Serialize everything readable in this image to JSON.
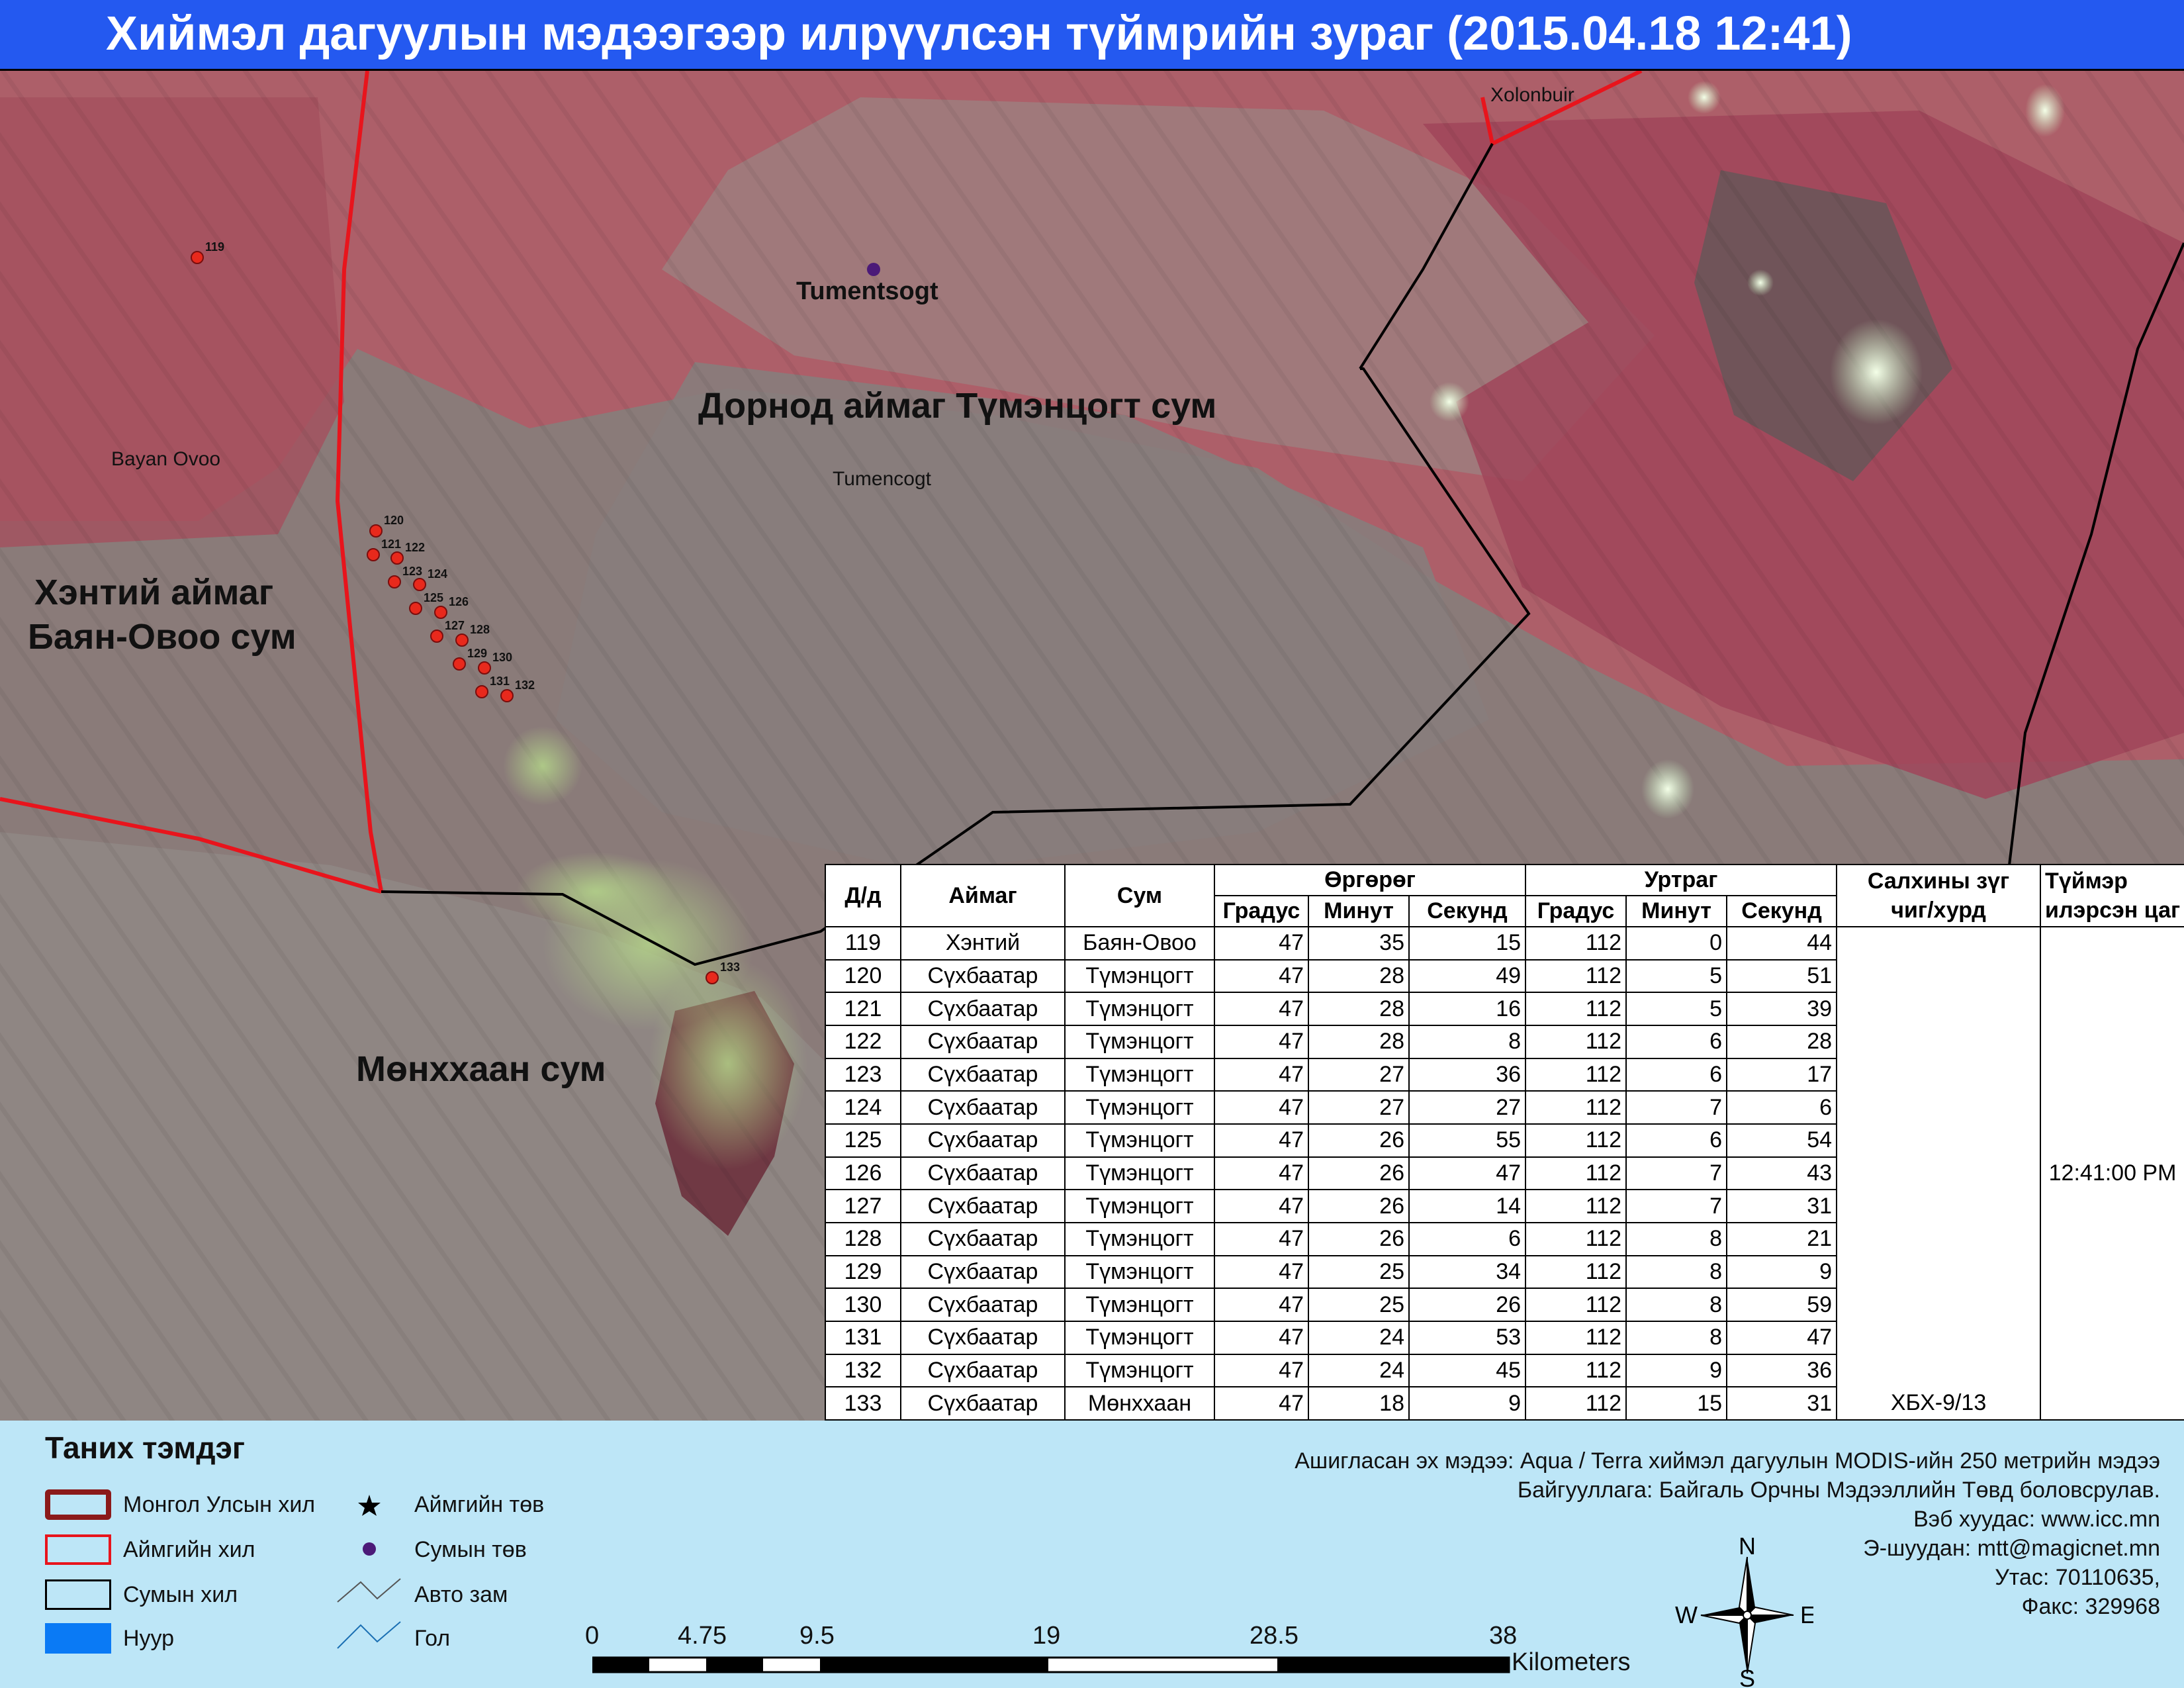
{
  "title": "Хиймэл дагуулын мэдээгээр илрүүлсэн түймрийн зураг  (2015.04.18 12:41)",
  "map": {
    "labels": {
      "bayan_ovoo_en": "Bayan Ovoo",
      "tumentsogt_en": "Tumentsogt",
      "tumencogt_en": "Tumencogt",
      "xolonbuir_en": "Xolonbuir",
      "dornod": "Дорнод аймаг Түмэнцогт сум",
      "khentii_line1": "Хэнтий аймаг",
      "khentii_line2": "Баян-Овоо сум",
      "munkhkhaan": "Мөнххаан сум"
    },
    "fire_points": [
      {
        "id": "119"
      },
      {
        "id": "120"
      },
      {
        "id": "121"
      },
      {
        "id": "122"
      },
      {
        "id": "123"
      },
      {
        "id": "124"
      },
      {
        "id": "125"
      },
      {
        "id": "126"
      },
      {
        "id": "127"
      },
      {
        "id": "128"
      },
      {
        "id": "129"
      },
      {
        "id": "130"
      },
      {
        "id": "131"
      },
      {
        "id": "132"
      },
      {
        "id": "133"
      }
    ],
    "colors": {
      "fire_point": "#e8291c",
      "aimag_border": "#e8141c",
      "sum_border": "#000000",
      "sum_center": "#4b1a78"
    }
  },
  "table": {
    "headers": {
      "id": "Д/д",
      "aimag": "Аймаг",
      "sum": "Сум",
      "latitude": "Өргөрөг",
      "longitude": "Уртраг",
      "deg": "Градус",
      "min": "Минут",
      "sec": "Секунд",
      "wind_line1": "Салхины зүг",
      "wind_line2": "чиг/хурд",
      "time_line1": "Түймэр",
      "time_line2": "илэрсэн цаг"
    },
    "rows": [
      {
        "id": "119",
        "aimag": "Хэнтий",
        "sum": "Баян-Овоо",
        "lat_deg": "47",
        "lat_min": "35",
        "lat_sec": "15",
        "lon_deg": "112",
        "lon_min": "0",
        "lon_sec": "44"
      },
      {
        "id": "120",
        "aimag": "Сүхбаатар",
        "sum": "Түмэнцогт",
        "lat_deg": "47",
        "lat_min": "28",
        "lat_sec": "49",
        "lon_deg": "112",
        "lon_min": "5",
        "lon_sec": "51"
      },
      {
        "id": "121",
        "aimag": "Сүхбаатар",
        "sum": "Түмэнцогт",
        "lat_deg": "47",
        "lat_min": "28",
        "lat_sec": "16",
        "lon_deg": "112",
        "lon_min": "5",
        "lon_sec": "39"
      },
      {
        "id": "122",
        "aimag": "Сүхбаатар",
        "sum": "Түмэнцогт",
        "lat_deg": "47",
        "lat_min": "28",
        "lat_sec": "8",
        "lon_deg": "112",
        "lon_min": "6",
        "lon_sec": "28"
      },
      {
        "id": "123",
        "aimag": "Сүхбаатар",
        "sum": "Түмэнцогт",
        "lat_deg": "47",
        "lat_min": "27",
        "lat_sec": "36",
        "lon_deg": "112",
        "lon_min": "6",
        "lon_sec": "17"
      },
      {
        "id": "124",
        "aimag": "Сүхбаатар",
        "sum": "Түмэнцогт",
        "lat_deg": "47",
        "lat_min": "27",
        "lat_sec": "27",
        "lon_deg": "112",
        "lon_min": "7",
        "lon_sec": "6"
      },
      {
        "id": "125",
        "aimag": "Сүхбаатар",
        "sum": "Түмэнцогт",
        "lat_deg": "47",
        "lat_min": "26",
        "lat_sec": "55",
        "lon_deg": "112",
        "lon_min": "6",
        "lon_sec": "54"
      },
      {
        "id": "126",
        "aimag": "Сүхбаатар",
        "sum": "Түмэнцогт",
        "lat_deg": "47",
        "lat_min": "26",
        "lat_sec": "47",
        "lon_deg": "112",
        "lon_min": "7",
        "lon_sec": "43"
      },
      {
        "id": "127",
        "aimag": "Сүхбаатар",
        "sum": "Түмэнцогт",
        "lat_deg": "47",
        "lat_min": "26",
        "lat_sec": "14",
        "lon_deg": "112",
        "lon_min": "7",
        "lon_sec": "31"
      },
      {
        "id": "128",
        "aimag": "Сүхбаатар",
        "sum": "Түмэнцогт",
        "lat_deg": "47",
        "lat_min": "26",
        "lat_sec": "6",
        "lon_deg": "112",
        "lon_min": "8",
        "lon_sec": "21"
      },
      {
        "id": "129",
        "aimag": "Сүхбаатар",
        "sum": "Түмэнцогт",
        "lat_deg": "47",
        "lat_min": "25",
        "lat_sec": "34",
        "lon_deg": "112",
        "lon_min": "8",
        "lon_sec": "9"
      },
      {
        "id": "130",
        "aimag": "Сүхбаатар",
        "sum": "Түмэнцогт",
        "lat_deg": "47",
        "lat_min": "25",
        "lat_sec": "26",
        "lon_deg": "112",
        "lon_min": "8",
        "lon_sec": "59"
      },
      {
        "id": "131",
        "aimag": "Сүхбаатар",
        "sum": "Түмэнцогт",
        "lat_deg": "47",
        "lat_min": "24",
        "lat_sec": "53",
        "lon_deg": "112",
        "lon_min": "8",
        "lon_sec": "47"
      },
      {
        "id": "132",
        "aimag": "Сүхбаатар",
        "sum": "Түмэнцогт",
        "lat_deg": "47",
        "lat_min": "24",
        "lat_sec": "45",
        "lon_deg": "112",
        "lon_min": "9",
        "lon_sec": "36"
      },
      {
        "id": "133",
        "aimag": "Сүхбаатар",
        "sum": "Мөнххаан",
        "lat_deg": "47",
        "lat_min": "18",
        "lat_sec": "9",
        "lon_deg": "112",
        "lon_min": "15",
        "lon_sec": "31"
      }
    ],
    "wind_value": "ХБХ-9/13",
    "detected_time": "12:41:00 PM"
  },
  "legend": {
    "title": "Таних тэмдэг",
    "items": {
      "country_border": "Монгол Улсын хил",
      "aimag_border": "Аймгийн хил",
      "sum_border": "Сумын хил",
      "lake": "Нуур",
      "aimag_center": "Аймгийн төв",
      "sum_center": "Сумын төв",
      "road": "Авто зам",
      "river": "Гол"
    },
    "colors": {
      "country_border": "#8b1a1a",
      "aimag_border": "#e8141c",
      "lake": "#0a7af5",
      "road": "#555555",
      "river": "#1a6fb3"
    }
  },
  "info": {
    "source": "Ашигласан эх мэдээ: Aqua / Terra хиймэл дагуулын MODIS-ийн 250 метрийн мэдээ",
    "org": "Байгууллага: Байгаль Орчны Мэдээллийн Төвд боловсрулав.",
    "web": "Вэб хуудас: www.icc.mn",
    "email": "Э-шуудан: mtt@magicnet.mn",
    "phone": "Утас: 70110635,",
    "fax": "Факс: 329968"
  },
  "scale": {
    "labels": [
      "0",
      "4.75",
      "9.5",
      "19",
      "28.5",
      "38"
    ],
    "unit": "Kilometers"
  },
  "compass": {
    "n": "N",
    "s": "S",
    "e": "E",
    "w": "W"
  }
}
